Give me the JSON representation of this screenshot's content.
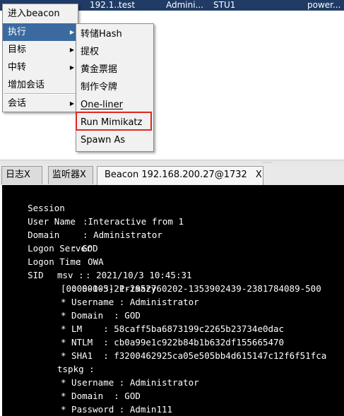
{
  "session_row": {
    "cells": [
      "192.1...",
      "test",
      "Admini...",
      "STU1",
      "power..."
    ]
  },
  "context_menu": {
    "items": [
      {
        "label": "进入beacon",
        "submenu": false
      },
      {
        "label": "执行",
        "submenu": true,
        "selected": true
      },
      {
        "label": "目标",
        "submenu": true
      },
      {
        "label": "中转",
        "submenu": true
      },
      {
        "label": "增加会话",
        "submenu": false
      },
      {
        "label": "会话",
        "submenu": true
      }
    ],
    "arrow": "▶"
  },
  "sub_menu": {
    "items": [
      "转储Hash",
      "提权",
      "黄金票据",
      "制作令牌",
      "One-liner",
      "Run Mimikatz",
      "Spawn As"
    ],
    "highlighted": "Run Mimikatz"
  },
  "tabs": [
    {
      "label": "日志",
      "close": "X"
    },
    {
      "label": "监听器",
      "close": "X"
    },
    {
      "label": "Beacon 192.168.200.27@1732",
      "close": "X",
      "active": true
    }
  ],
  "console": {
    "lines": [
      {
        "label": "Session",
        "value": "Interactive from 1"
      },
      {
        "label": "User Name",
        "value": "Administrator"
      },
      {
        "label": "Domain",
        "value": "GOD"
      },
      {
        "label": "Logon Server",
        "value": "OWA"
      },
      {
        "label": "Logon Time",
        "value": "2021/10/3 10:45:31"
      },
      {
        "label": "SID",
        "value": "S-1-5-21-2952760202-1353902439-2381784089-500"
      },
      {
        "text": "msv :"
      },
      {
        "text": "[00000003] Primary"
      },
      {
        "text": "* Username : Administrator"
      },
      {
        "text": "* Domain  : GOD"
      },
      {
        "text": "* LM    : 58caff5ba6873199c2265b23734e0dac"
      },
      {
        "text": "* NTLM  : cb0a99e1c922b84b1b632df155665470"
      },
      {
        "text": "* SHA1  : f3200462925ca05e505bb4d615147c12f6f51fca"
      },
      {
        "text": "tspkg :"
      },
      {
        "text": "* Username : Administrator"
      },
      {
        "text": "* Domain  : GOD"
      },
      {
        "text": "* Password : Admin111"
      }
    ]
  },
  "colors": {
    "selection": "#3b6aa0",
    "highlight_box": "#e0261f",
    "console_bg": "#000000",
    "console_fg": "#ffffff",
    "session_row_bg": "#1f3b66"
  }
}
